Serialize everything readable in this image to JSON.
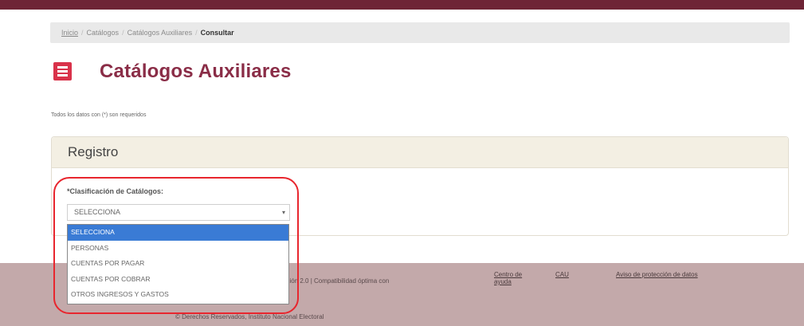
{
  "breadcrumb": {
    "items": [
      "Inicio",
      "Catálogos",
      "Catálogos Auxiliares"
    ],
    "current": "Consultar"
  },
  "page": {
    "title": "Catálogos Auxiliares",
    "required_note": "Todos los datos con (*) son requeridos"
  },
  "panel": {
    "title": "Registro",
    "field_label": "*Clasificación de Catálogos:",
    "select_value": "SELECCIONA",
    "options": [
      "SELECCIONA",
      "PERSONAS",
      "CUENTAS POR PAGAR",
      "CUENTAS POR COBRAR",
      "OTROS INGRESOS Y GASTOS"
    ],
    "selected_index": 0
  },
  "footer": {
    "version_text": "ación 2.0 | Compatibilidad óptima con",
    "links": {
      "help_line1": "Centro de",
      "help_line2": "ayuda",
      "faq": "CAU",
      "privacy": "Aviso de protección de datos"
    },
    "copyright": "© Derechos Reservados, Instituto Nacional Electoral"
  },
  "colors": {
    "top_bar": "#6e2436",
    "title": "#8a2d47",
    "menu_button": "#d9324a",
    "highlight": "#e8262e",
    "selected_option": "#3a7bd5"
  },
  "icons": {
    "menu": "hamburger-icon",
    "dropdown_arrow": "caret-down-icon"
  }
}
